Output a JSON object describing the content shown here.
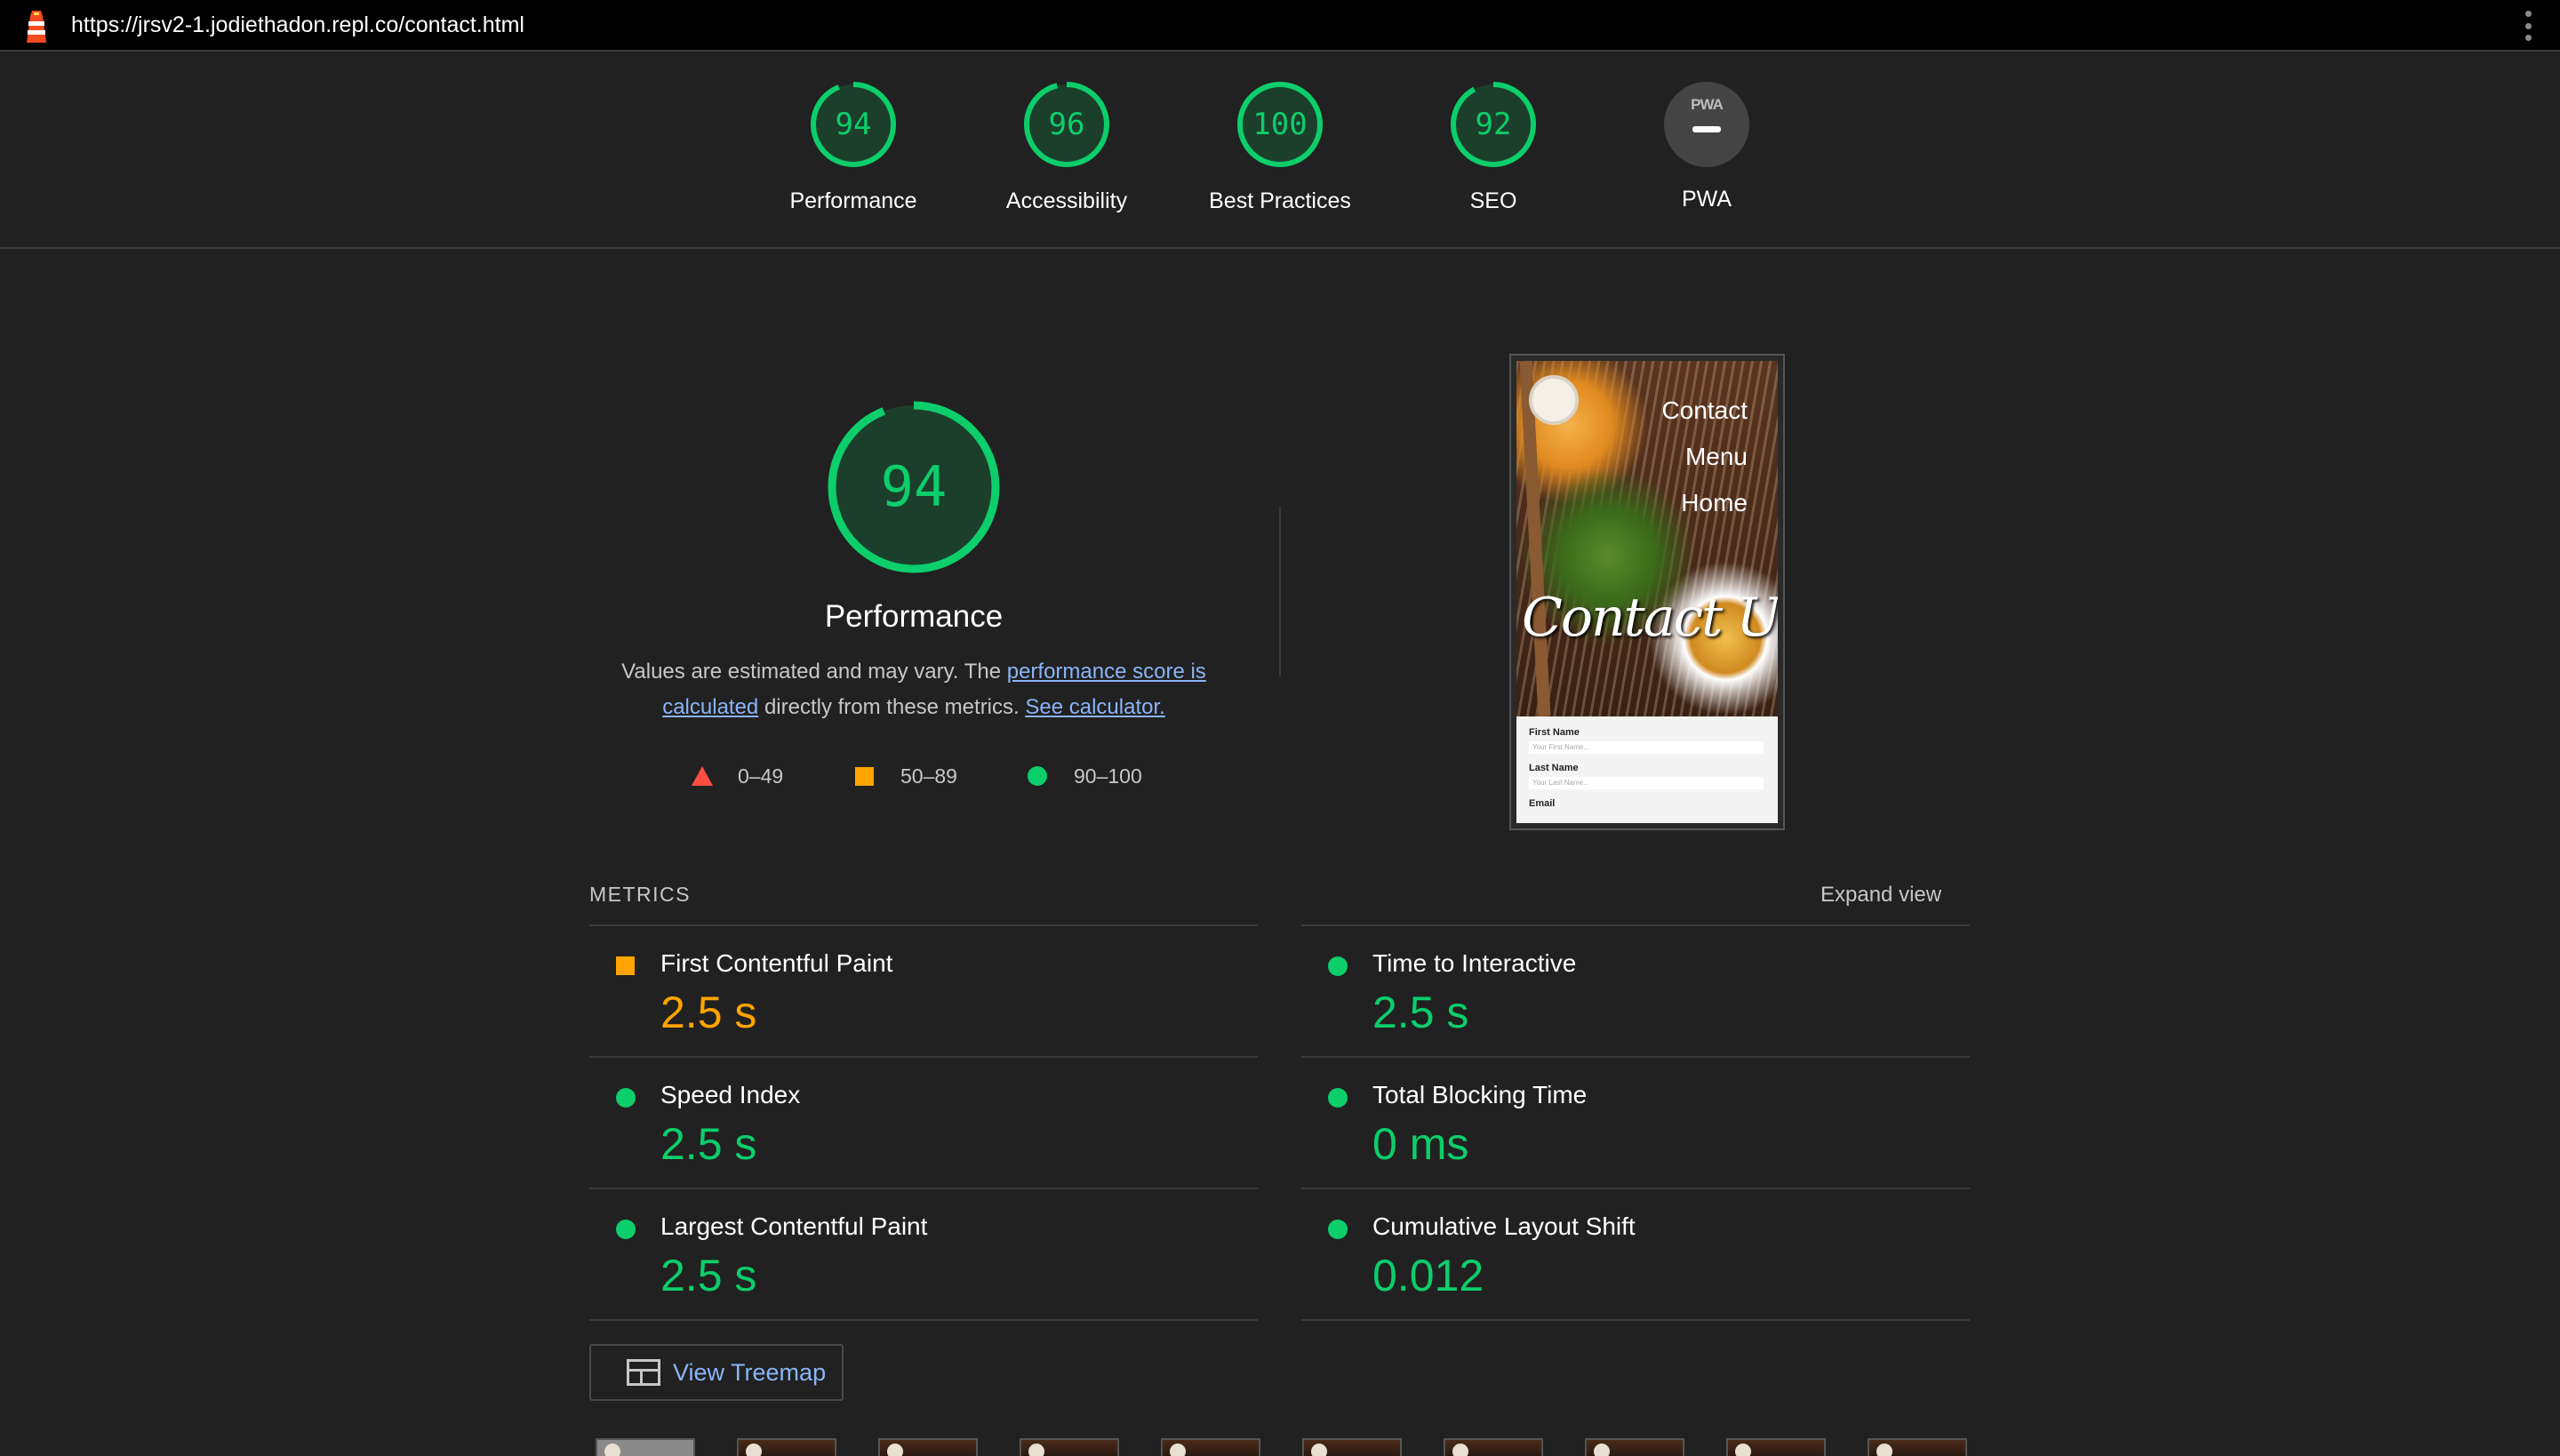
{
  "browser": {
    "url": "https://jrsv2-1.jodiethadon.repl.co/contact.html",
    "logo_icon": "lighthouse-icon",
    "menu_icon": "kebab-menu-icon"
  },
  "summary_scores": [
    {
      "value": 94,
      "label": "Performance"
    },
    {
      "value": 96,
      "label": "Accessibility"
    },
    {
      "value": 100,
      "label": "Best Practices"
    },
    {
      "value": 92,
      "label": "SEO"
    }
  ],
  "pwa": {
    "badge_text": "PWA",
    "label": "PWA"
  },
  "performance": {
    "score": 94,
    "title": "Performance",
    "desc_prefix": "Values are estimated and may vary. The ",
    "desc_link1": "performance score is calculated",
    "desc_middle": " directly from these metrics. ",
    "desc_link2": "See calculator.",
    "legend": [
      {
        "shape": "triangle",
        "range": "0–49",
        "color": "#ff4e42"
      },
      {
        "shape": "square",
        "range": "50–89",
        "color": "#ffa400"
      },
      {
        "shape": "circle",
        "range": "90–100",
        "color": "#0cce6b"
      }
    ]
  },
  "screenshot": {
    "nav": [
      "Contact",
      "Menu",
      "Home"
    ],
    "hero": "Contact Us",
    "form": [
      {
        "label": "First Name",
        "placeholder": "Your First Name..."
      },
      {
        "label": "Last Name",
        "placeholder": "Your Last Name..."
      },
      {
        "label": "Email",
        "placeholder": ""
      }
    ]
  },
  "metrics": {
    "header": "METRICS",
    "expand": "Expand view",
    "items": [
      {
        "name": "First Contentful Paint",
        "value": "2.5 s",
        "status": "average"
      },
      {
        "name": "Time to Interactive",
        "value": "2.5 s",
        "status": "pass"
      },
      {
        "name": "Speed Index",
        "value": "2.5 s",
        "status": "pass"
      },
      {
        "name": "Total Blocking Time",
        "value": "0 ms",
        "status": "pass"
      },
      {
        "name": "Largest Contentful Paint",
        "value": "2.5 s",
        "status": "pass"
      },
      {
        "name": "Cumulative Layout Shift",
        "value": "0.012",
        "status": "pass"
      }
    ]
  },
  "treemap_button": {
    "label": "View Treemap",
    "icon": "treemap-icon"
  },
  "colors": {
    "pass": "#0cce6b",
    "average": "#ffa400",
    "fail": "#ff4e42",
    "background": "#212121"
  }
}
